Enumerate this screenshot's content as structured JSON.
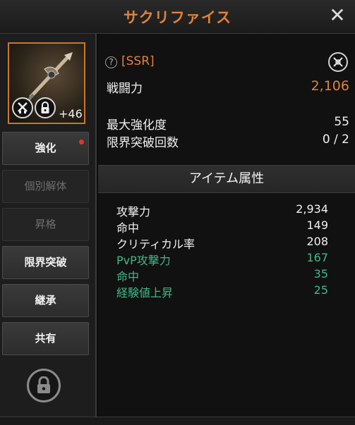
{
  "header": {
    "title": "サクリファイス",
    "close_icon": "close-icon"
  },
  "item": {
    "enhance_level": "+46",
    "icons": [
      "weapon-icon",
      "swords-icon",
      "lock-icon"
    ],
    "frame_color": "#c9772a"
  },
  "sidebar": {
    "buttons": [
      {
        "label": "強化",
        "enabled": true,
        "notification": true
      },
      {
        "label": "個別解体",
        "enabled": false
      },
      {
        "label": "昇格",
        "enabled": false
      },
      {
        "label": "限界突破",
        "enabled": true
      },
      {
        "label": "継承",
        "enabled": true
      },
      {
        "label": "共有",
        "enabled": true
      }
    ],
    "lock_icon": "lock-icon"
  },
  "detail": {
    "grade": "[SSR]",
    "help_glyph": "?",
    "power_label": "戦闘力",
    "power_value": "2,106",
    "max_enhance_label": "最大強化度",
    "max_enhance_value": "55",
    "limit_break_label": "限界突破回数",
    "limit_break_value": "0 / 2"
  },
  "attributes": {
    "header": "アイテム属性",
    "rows": [
      {
        "label": "攻撃力",
        "value": "2,934",
        "color": "#f1f1f1"
      },
      {
        "label": "命中",
        "value": "149",
        "color": "#f1f1f1"
      },
      {
        "label": "クリティカル率",
        "value": "208",
        "color": "#f1f1f1"
      },
      {
        "label": "PvP攻撃力",
        "value": "167",
        "color": "#3fb88a"
      },
      {
        "label": "命中",
        "value": "35",
        "color": "#3fb88a"
      },
      {
        "label": "経験値上昇",
        "value": "25",
        "color": "#3fb88a"
      }
    ]
  },
  "colors": {
    "accent": "#e0823a",
    "bonus": "#3fb88a",
    "notify": "#e8322c"
  }
}
